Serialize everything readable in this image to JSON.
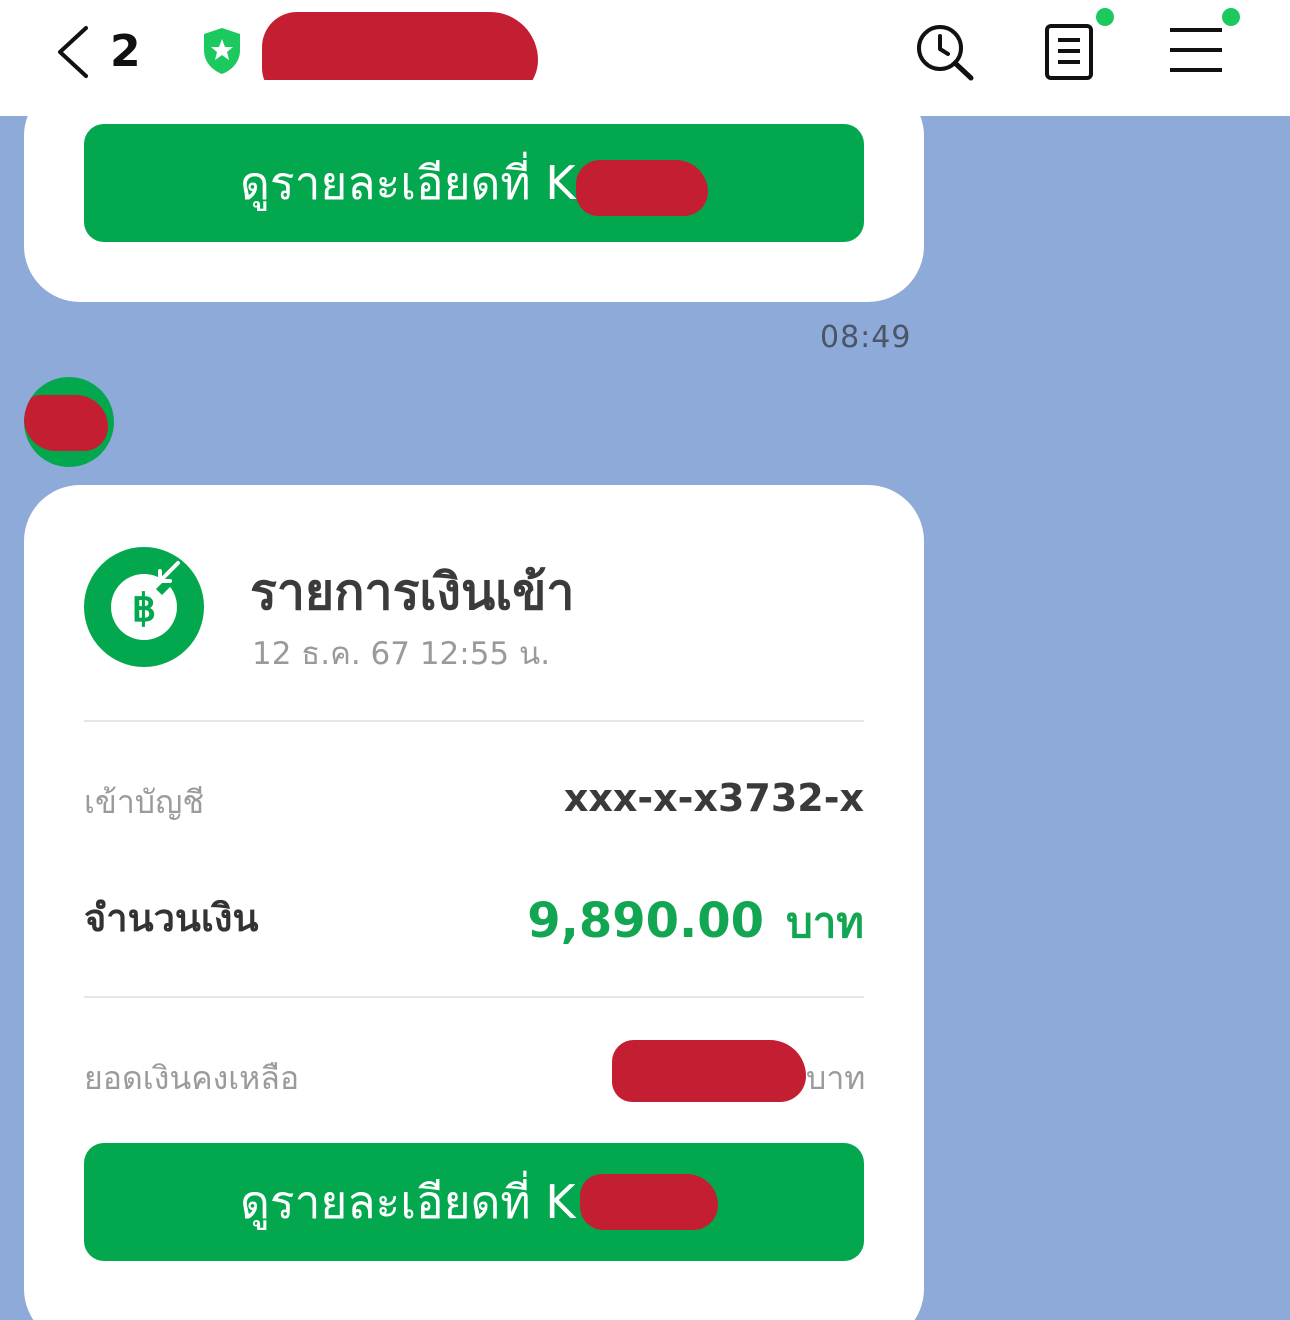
{
  "header": {
    "unread_count": "2",
    "icons": [
      "chevron-left-icon",
      "shield-star-icon",
      "history-search-icon",
      "notes-icon",
      "menu-icon"
    ],
    "accent_green": "#1cc95e"
  },
  "messages": [
    {
      "button_label": "ดูรายละเอียดที่ K",
      "time": "08:49"
    },
    {
      "title": "รายการเงินเข้า",
      "datetime": "12 ธ.ค. 67 12:55  น.",
      "account_label": "เข้าบัญชี",
      "account_value": "xxx-x-x3732-x",
      "amount_label": "จำนวนเงิน",
      "amount_value": "9,890.00",
      "amount_unit": "บาท",
      "balance_label": "ยอดเงินคงเหลือ",
      "balance_unit": "บาท",
      "button_label": "ดูรายละเอียดที่ K"
    }
  ],
  "colors": {
    "chat_background": "#8eaad8",
    "brand_green": "#03a84e",
    "amount_green": "#12a552",
    "redaction": "#c41e32"
  }
}
